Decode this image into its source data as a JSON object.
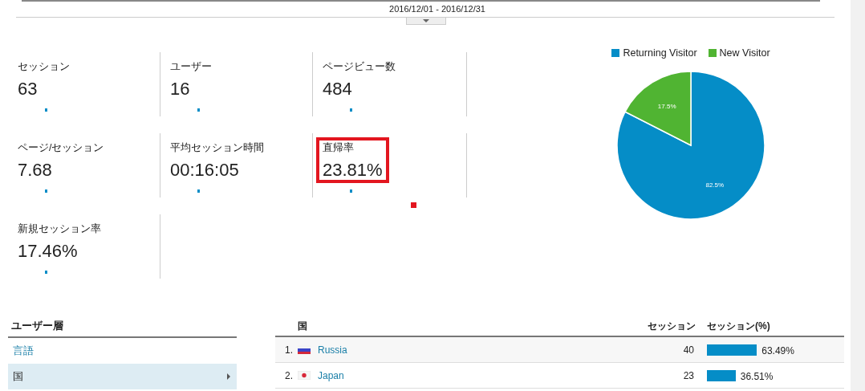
{
  "date_range": "2016/12/01 - 2016/12/31",
  "metrics": [
    {
      "label": "セッション",
      "value": "63",
      "highlighted": false
    },
    {
      "label": "ユーザー",
      "value": "16",
      "highlighted": false
    },
    {
      "label": "ページビュー数",
      "value": "484",
      "highlighted": false
    },
    {
      "label": "ページ/セッション",
      "value": "7.68",
      "highlighted": false
    },
    {
      "label": "平均セッション時間",
      "value": "00:16:05",
      "highlighted": false
    },
    {
      "label": "直帰率",
      "value": "23.81%",
      "highlighted": true
    },
    {
      "label": "新規セッション率",
      "value": "17.46%",
      "highlighted": false
    }
  ],
  "pie": {
    "chart_data": {
      "type": "pie",
      "categories": [
        "Returning Visitor",
        "New Visitor"
      ],
      "series": [
        {
          "values": [
            82.5,
            17.5
          ]
        }
      ],
      "value_labels": [
        "82.5%",
        "17.5%"
      ]
    },
    "legend": [
      {
        "color": "#058dc7"
      },
      {
        "color": "#50b432"
      }
    ]
  },
  "audience": {
    "title": "ユーザー層",
    "items": [
      {
        "label": "言語",
        "selected": false
      },
      {
        "label": "国",
        "selected": true
      }
    ]
  },
  "table": {
    "columns": [
      "国",
      "セッション",
      "セッション(%)"
    ],
    "rows": [
      {
        "rank": "1.",
        "kind": "russia",
        "country": "Russia",
        "sessions": "40",
        "percent": "63.49%"
      },
      {
        "rank": "2.",
        "kind": "japan",
        "country": "Japan",
        "sessions": "23",
        "percent": "36.51%"
      }
    ]
  }
}
